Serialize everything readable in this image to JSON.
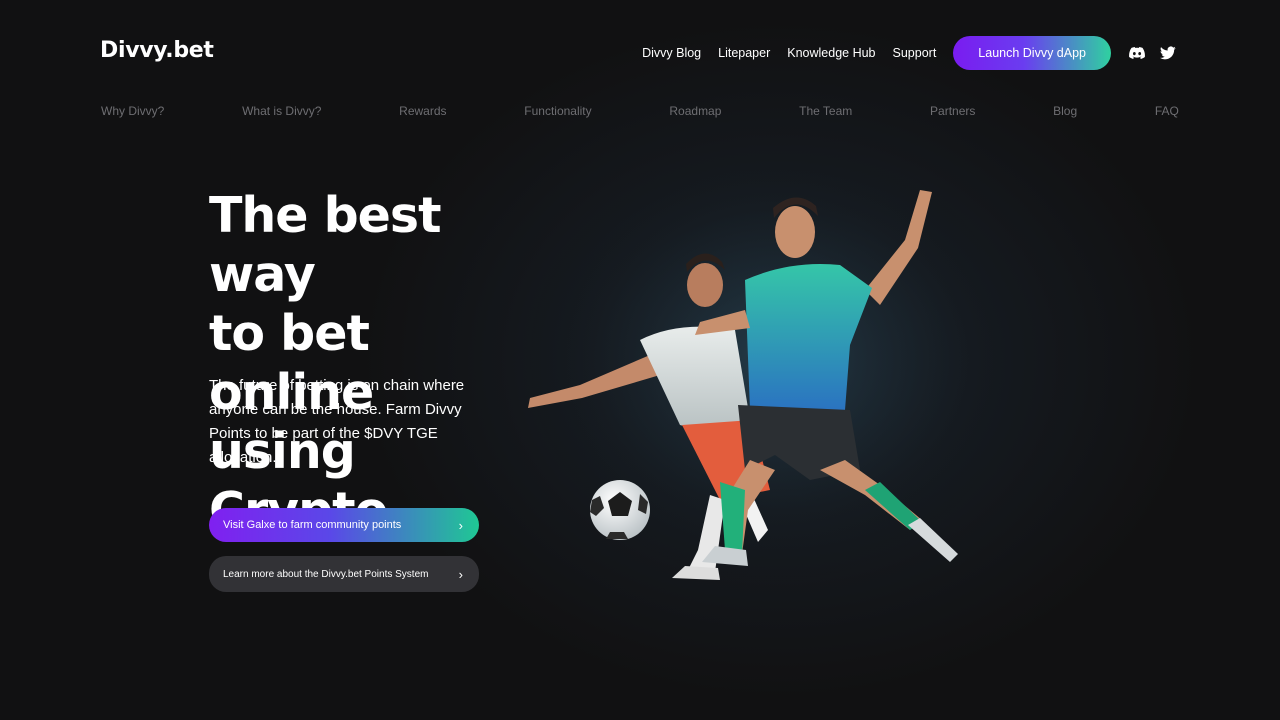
{
  "header": {
    "logo": "Divvy.bet",
    "nav": [
      "Divvy Blog",
      "Litepaper",
      "Knowledge Hub",
      "Support"
    ],
    "launch_label": "Launch Divvy dApp",
    "social_icons": [
      "discord-icon",
      "twitter-icon"
    ]
  },
  "section_nav": [
    "Why Divvy?",
    "What is Divvy?",
    "Rewards",
    "Functionality",
    "Roadmap",
    "The Team",
    "Partners",
    "Blog",
    "FAQ"
  ],
  "hero": {
    "title_lines": [
      "The best way",
      "to bet online",
      "using Crypto."
    ],
    "subtitle": "The future of betting is on chain where anyone can be the house. Farm Divvy Points to be part of the $DVY TGE allocation.",
    "cta_primary": "Visit Galxe to farm community points",
    "cta_secondary": "Learn more about the Divvy.bet Points System",
    "chevron": "›"
  },
  "colors": {
    "background": "#111112",
    "accent_purple": "#7a1cf0",
    "accent_green": "#2fd1a0",
    "nav_muted": "#6e6e72"
  }
}
